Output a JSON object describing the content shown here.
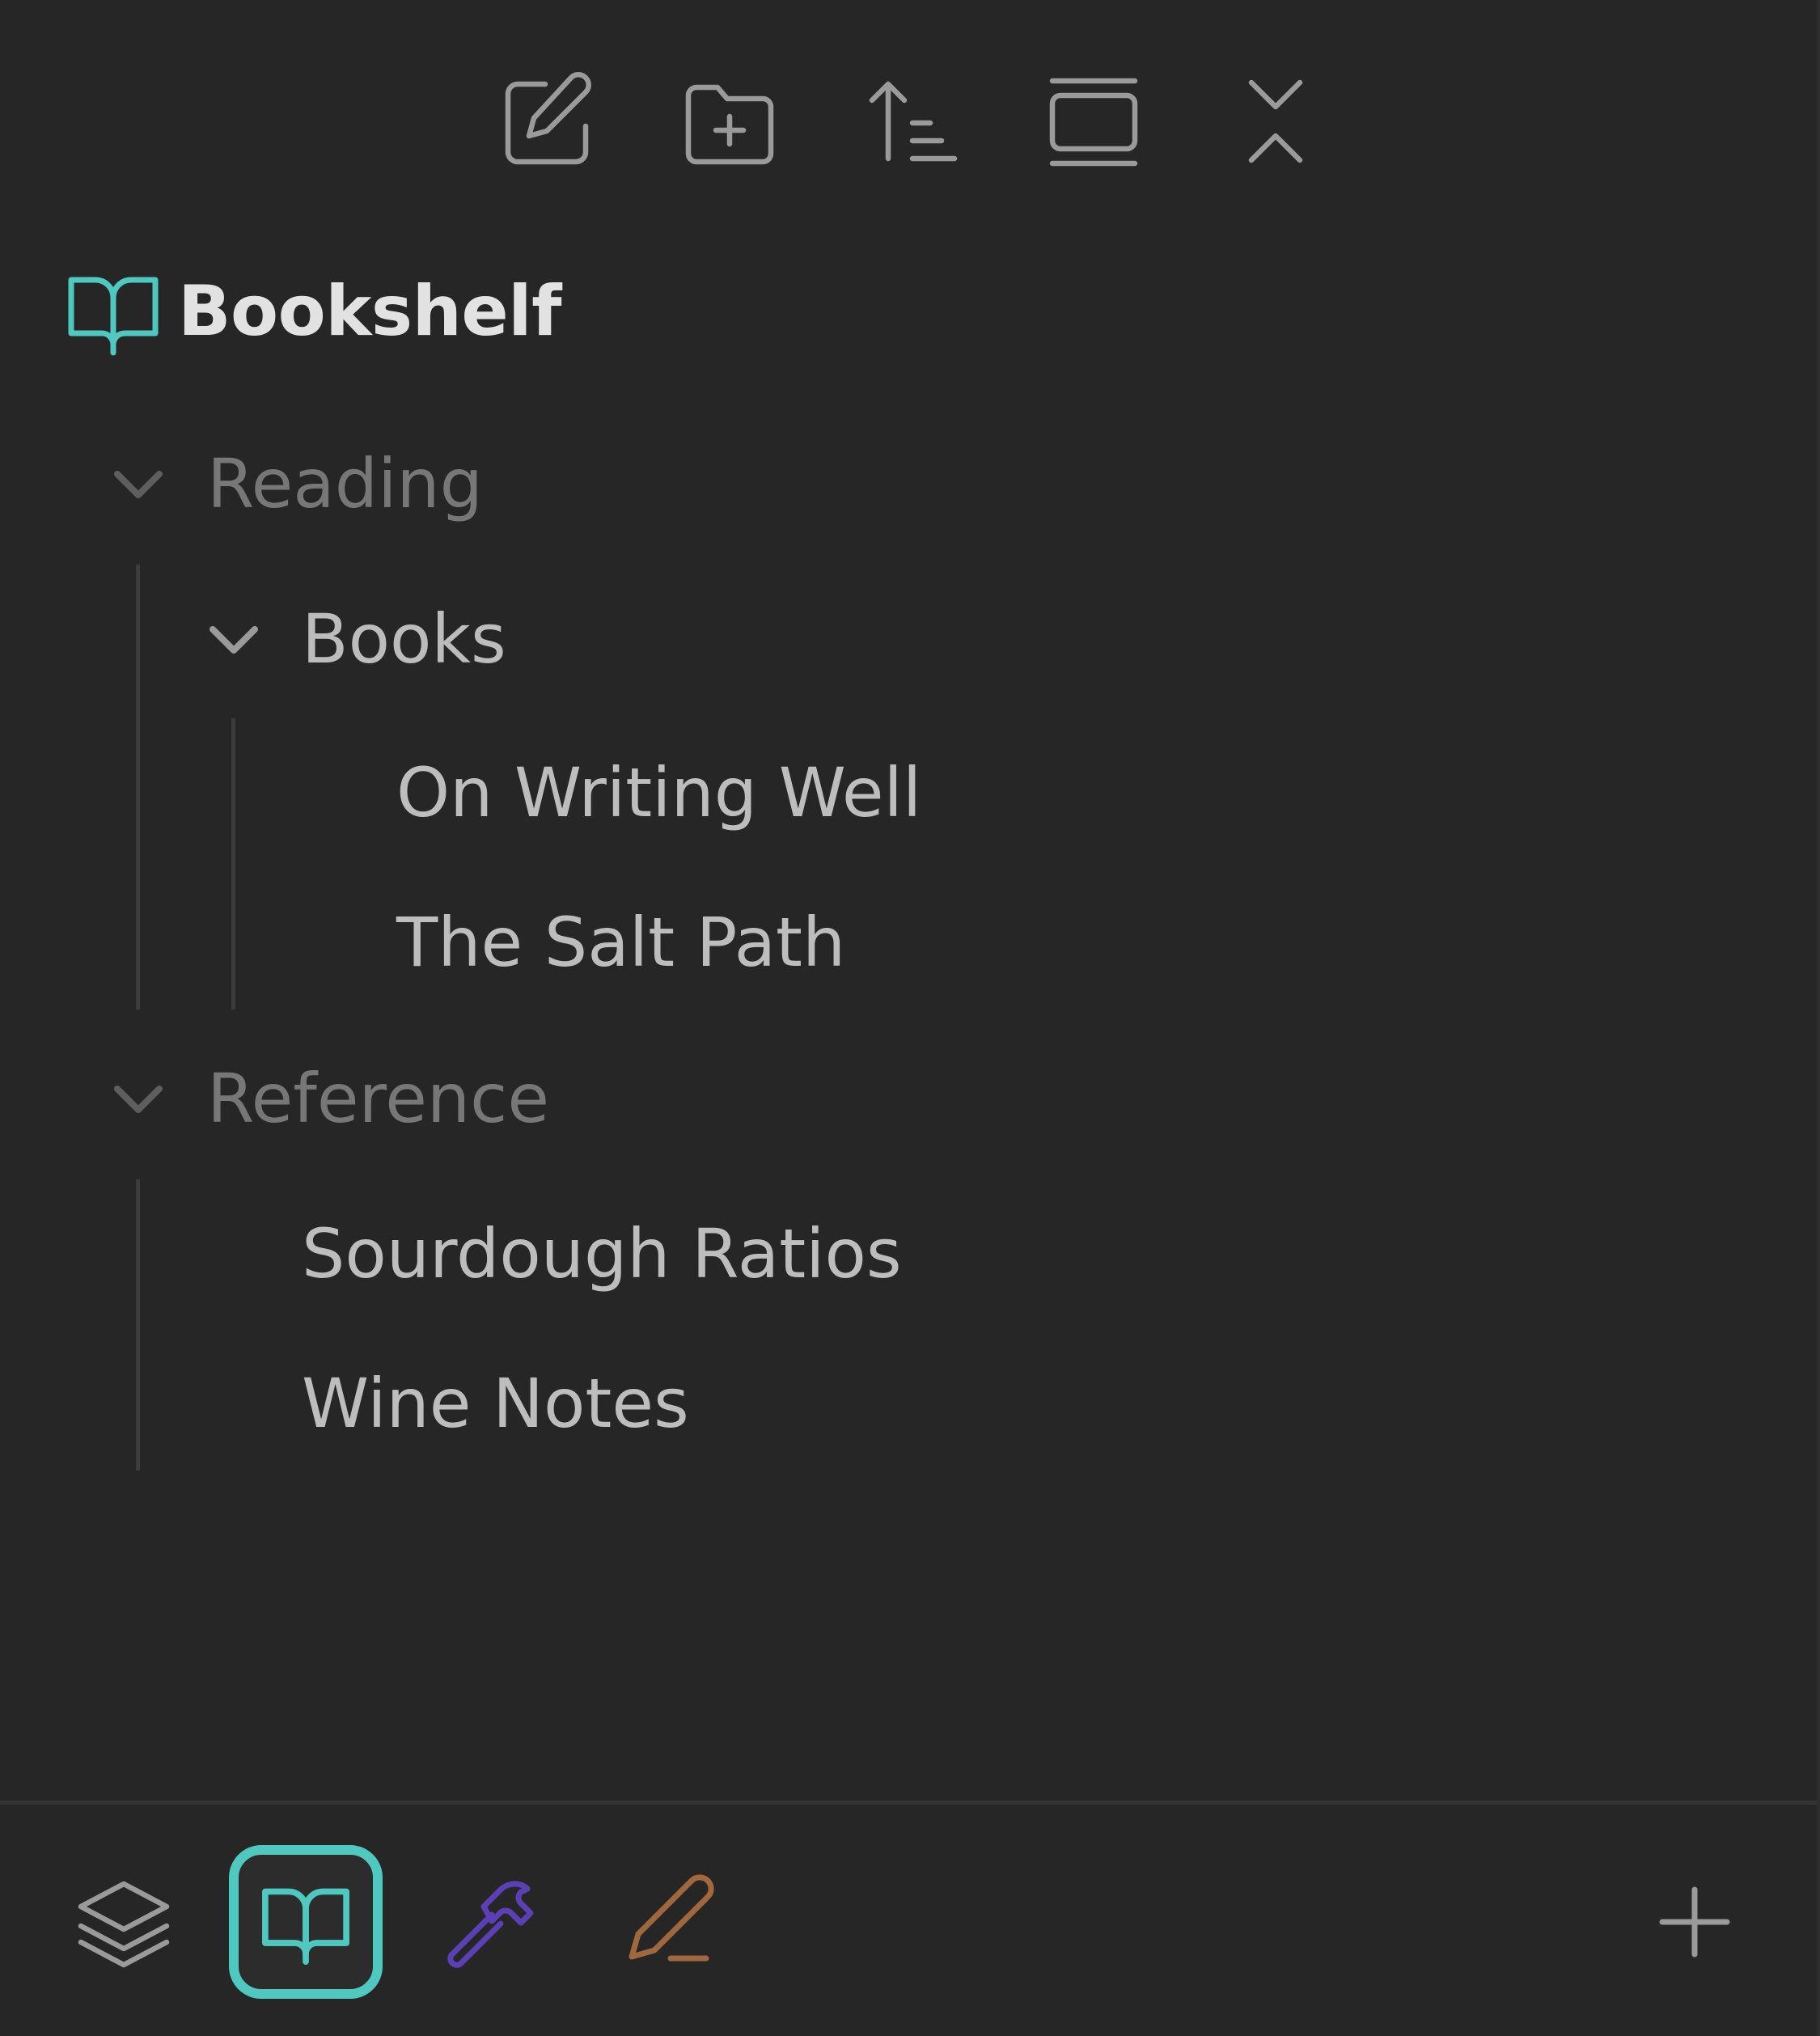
{
  "toolbar": {
    "buttons": [
      {
        "name": "new-note",
        "icon": "edit-note-icon"
      },
      {
        "name": "new-folder",
        "icon": "folder-plus-icon"
      },
      {
        "name": "sort",
        "icon": "sort-ascending-icon"
      },
      {
        "name": "auto-reveal",
        "icon": "gallery-vertical-icon"
      },
      {
        "name": "collapse-all",
        "icon": "chevrons-down-up-icon"
      }
    ]
  },
  "vault": {
    "title": "Bookshelf",
    "icon": "book-open-icon",
    "accent_color": "#4fc8c0"
  },
  "tree": {
    "folders": [
      {
        "label": "Reading",
        "expanded": true,
        "children": [
          {
            "label": "Books",
            "expanded": true,
            "files": [
              "On Writing Well",
              "The Salt Path"
            ]
          }
        ]
      },
      {
        "label": "Reference",
        "expanded": true,
        "files": [
          "Sourdough Ratios",
          "Wine Notes"
        ]
      }
    ]
  },
  "ribbon": {
    "items": [
      {
        "name": "vault-stack",
        "icon": "layers-icon",
        "color": "#9a9a9a",
        "active": false
      },
      {
        "name": "bookshelf",
        "icon": "book-open-icon",
        "color": "#4fc8c0",
        "active": true
      },
      {
        "name": "tools",
        "icon": "hammer-icon",
        "color": "#5b3fb5",
        "active": false
      },
      {
        "name": "drafts",
        "icon": "pencil-line-icon",
        "color": "#a0683c",
        "active": false
      }
    ],
    "add": {
      "icon": "plus-icon",
      "color": "#9a9a9a"
    }
  }
}
